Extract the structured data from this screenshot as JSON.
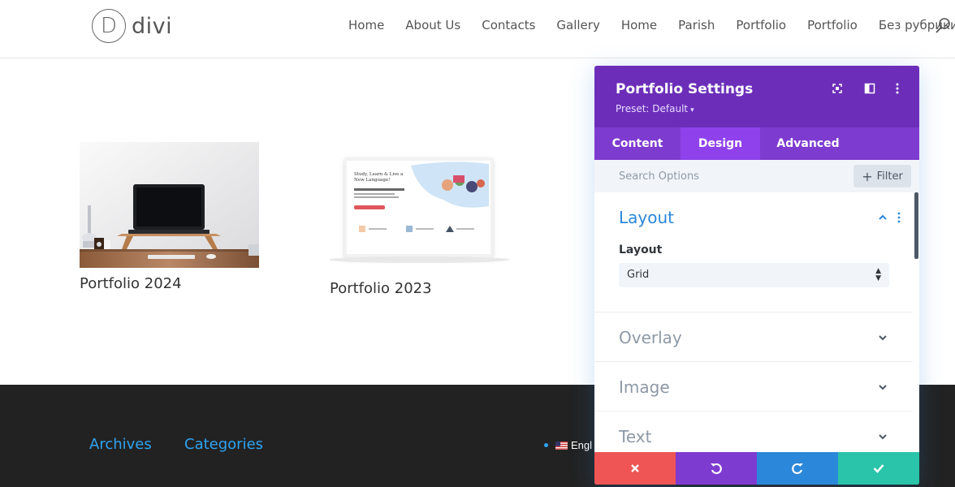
{
  "header": {
    "logo_letter": "D",
    "logo_text": "divi",
    "nav": [
      "Home",
      "About Us",
      "Contacts",
      "Gallery",
      "Home",
      "Parish",
      "Portfolio",
      "Portfolio",
      "Без рубрики"
    ]
  },
  "portfolio": {
    "items": [
      {
        "title": "Portfolio 2024"
      },
      {
        "title": "Portfolio 2023"
      }
    ],
    "mockup_text": "Study, Learn & Live a New Language!"
  },
  "footer": {
    "widgets": [
      "Archives",
      "Categories"
    ],
    "language": "Engl"
  },
  "settings": {
    "title": "Portfolio Settings",
    "preset": "Preset: Default",
    "tabs": [
      "Content",
      "Design",
      "Advanced"
    ],
    "active_tab": "Design",
    "search_placeholder": "Search Options",
    "filter_label": "Filter",
    "sections": [
      {
        "title": "Layout",
        "open": true,
        "field_label": "Layout",
        "field_value": "Grid"
      },
      {
        "title": "Overlay",
        "open": false
      },
      {
        "title": "Image",
        "open": false
      },
      {
        "title": "Text",
        "open": false
      }
    ],
    "buttons": [
      "cancel",
      "undo",
      "redo",
      "save"
    ]
  },
  "colors": {
    "accent": "#2ea3f2",
    "modal_header": "#6c2eb9",
    "tabs_bg": "#7e3bd0",
    "tab_active": "#8f42ec",
    "cancel": "#ef5555",
    "undo": "#7e3bd0",
    "redo": "#2b87da",
    "save": "#29c4a9"
  }
}
